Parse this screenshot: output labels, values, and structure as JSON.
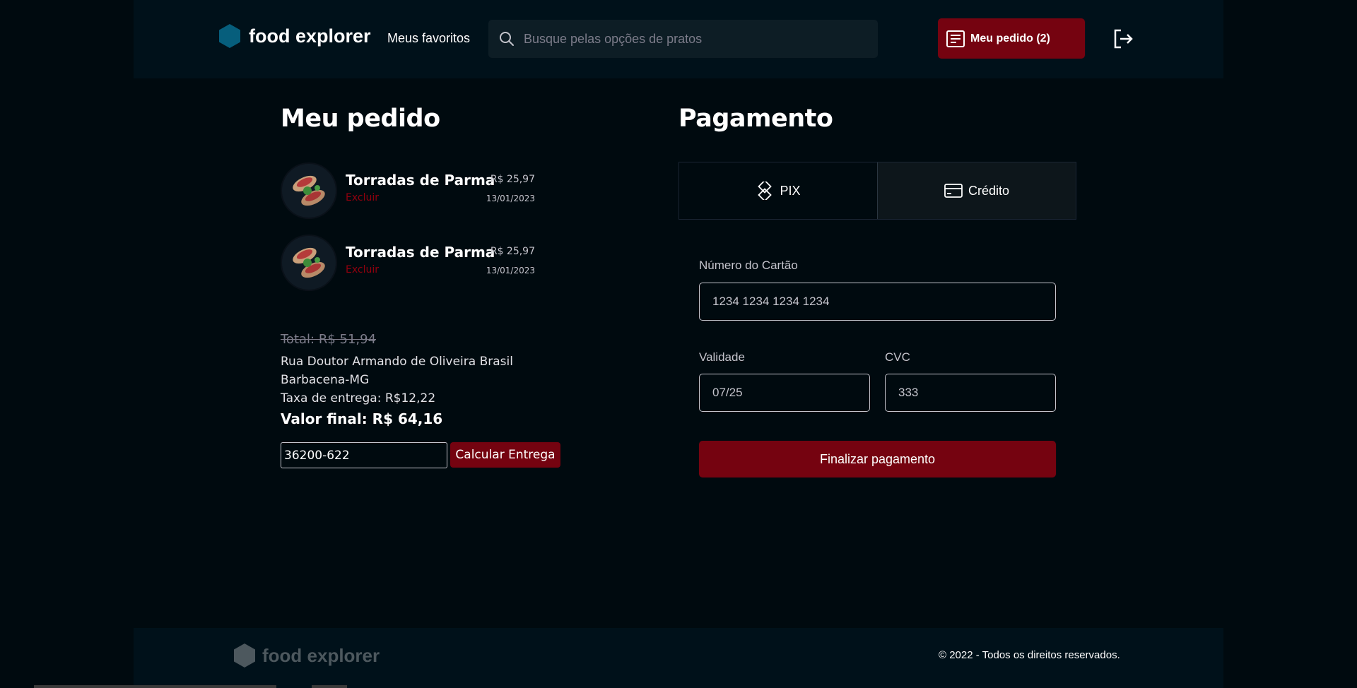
{
  "header": {
    "brand": "food explorer",
    "favorites": "Meus favoritos",
    "search_placeholder": "Busque pelas opções de pratos",
    "order_button": "Meu pedido (2)"
  },
  "order": {
    "title": "Meu pedido",
    "items": [
      {
        "name": "Torradas de Parma",
        "price": "R$ 25,97",
        "remove": "Excluir",
        "date": "13/01/2023"
      },
      {
        "name": "Torradas de Parma",
        "price": "R$ 25,97",
        "remove": "Excluir",
        "date": "13/01/2023"
      }
    ],
    "total_old": "Total: R$ 51,94",
    "address_line1": "Rua Doutor Armando de Oliveira Brasil",
    "address_line2": "Barbacena-MG",
    "delivery_fee": "Taxa de entrega: R$12,22",
    "final_value": "Valor final: R$ 64,16",
    "cep_value": "36200-622",
    "calc_button": "Calcular Entrega"
  },
  "payment": {
    "title": "Pagamento",
    "tabs": [
      {
        "label": "PIX",
        "active": false
      },
      {
        "label": "Crédito",
        "active": true
      }
    ],
    "card_number_label": "Número do Cartão",
    "card_number_value": "1234 1234 1234 1234",
    "validity_label": "Validade",
    "validity_value": "07/25",
    "cvc_label": "CVC",
    "cvc_value": "333",
    "finish_button": "Finalizar pagamento"
  },
  "footer": {
    "brand": "food explorer",
    "copyright": "© 2022 - Todos os direitos reservados."
  },
  "colors": {
    "accent": "#750310",
    "brand_hex": "#065e7c",
    "background": "#000a0f",
    "header_bg": "#00111a"
  }
}
